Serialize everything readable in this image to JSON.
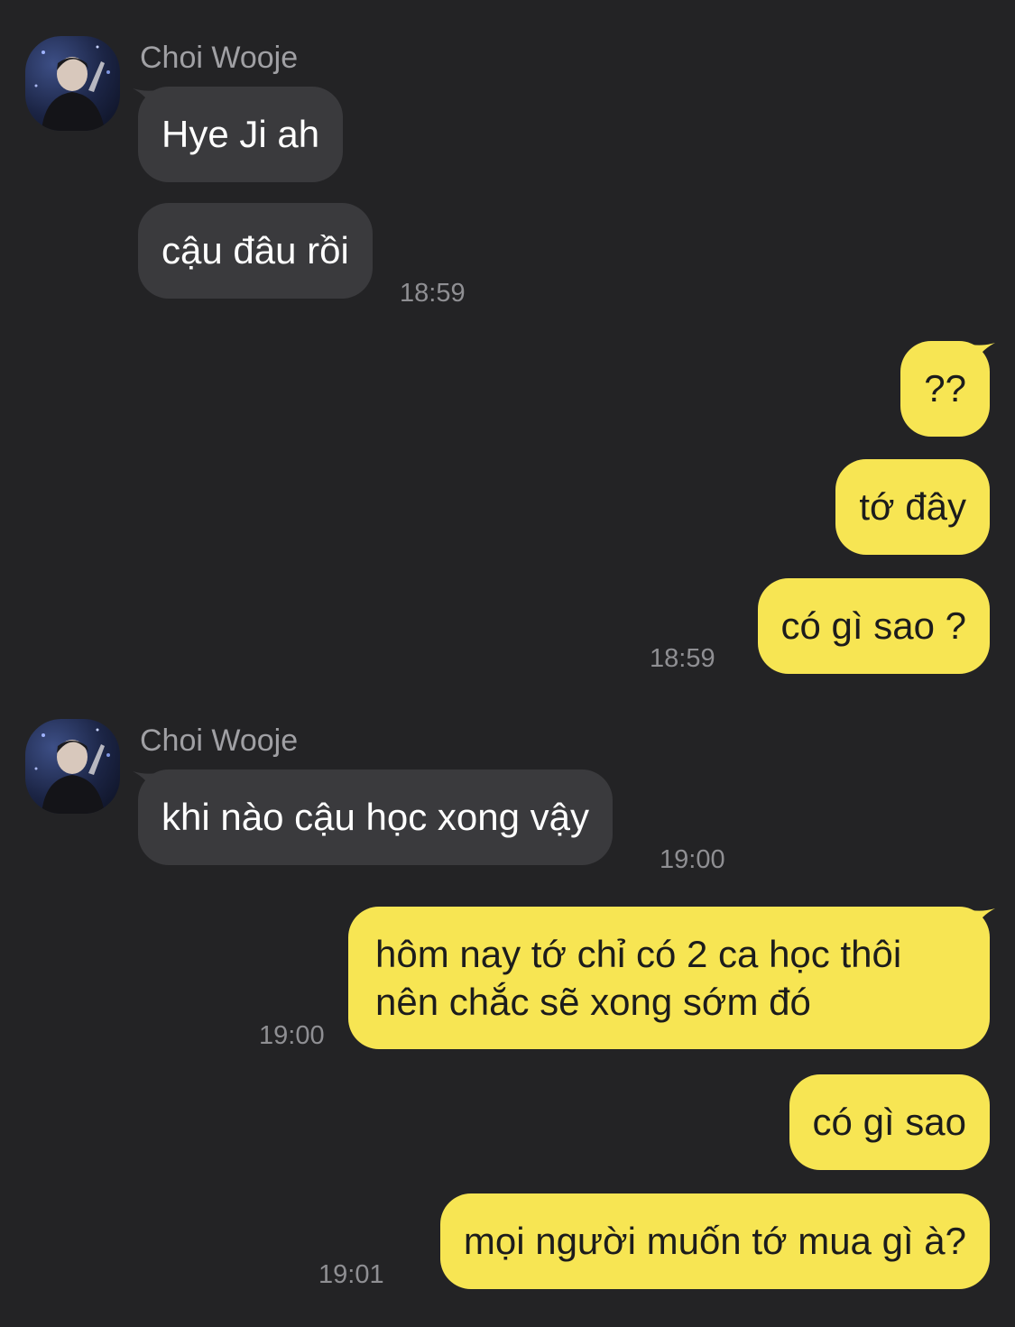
{
  "chat": {
    "contact_name": "Choi Wooje",
    "messages": [
      {
        "text": "Hye Ji ah"
      },
      {
        "text": "cậu đâu rồi",
        "time": "18:59"
      },
      {
        "text": "??"
      },
      {
        "text": "tớ đây"
      },
      {
        "text": "có gì sao ?",
        "time": "18:59"
      },
      {
        "text": "khi nào cậu học xong vậy",
        "time": "19:00"
      },
      {
        "text_line1": "hôm nay tớ chỉ có 2 ca học thôi",
        "text_line2": "nên chắc sẽ xong sớm đó",
        "time": "19:00"
      },
      {
        "text": "có gì sao"
      },
      {
        "text": "mọi người muốn tớ mua gì à?",
        "time": "19:01"
      }
    ]
  },
  "colors": {
    "background": "#232325",
    "incoming_bubble": "#3a3a3d",
    "outgoing_bubble": "#f7e553",
    "timestamp": "#8f8f93"
  },
  "icons": {
    "avatar": "profile-photo"
  }
}
